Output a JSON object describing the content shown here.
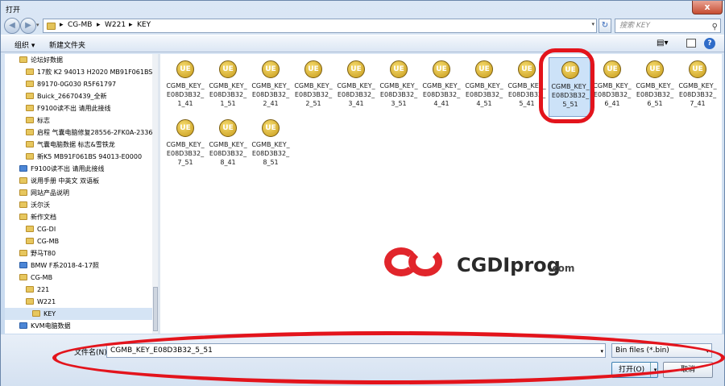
{
  "window": {
    "title": "打开",
    "close_label": "x"
  },
  "address": {
    "crumbs": [
      "▸",
      "CG-MB",
      "▸",
      "W221",
      "▸",
      "KEY"
    ],
    "search_placeholder": "搜索 KEY"
  },
  "toolbar": {
    "organize": "组织 ▾",
    "new_folder": "新建文件夹"
  },
  "nav_items": [
    {
      "label": "论坛好数据",
      "indent": 1,
      "icon": "folder"
    },
    {
      "label": "17款 K2  94013 H2020 MB91F061BS",
      "indent": 2,
      "icon": "folder"
    },
    {
      "label": "89170-0G030   R5F61797",
      "indent": 2,
      "icon": "folder"
    },
    {
      "label": "Buick_26670439_全新",
      "indent": 2,
      "icon": "folder"
    },
    {
      "label": "F9100读不出 请用此接线",
      "indent": 2,
      "icon": "folder"
    },
    {
      "label": "标志",
      "indent": 2,
      "icon": "folder"
    },
    {
      "label": "启程 气囊电脑修复28556-2FK0A-2336",
      "indent": 2,
      "icon": "folder"
    },
    {
      "label": "气囊电脑数据  标志&雪铁龙",
      "indent": 2,
      "icon": "folder"
    },
    {
      "label": "新K5   MB91F061BS   94013-E0000",
      "indent": 2,
      "icon": "folder"
    },
    {
      "label": "F9100读不出 请用此接线",
      "indent": 1,
      "icon": "doc"
    },
    {
      "label": "说用手册 中英文 双语板",
      "indent": 1,
      "icon": "folder"
    },
    {
      "label": "网站产品说明",
      "indent": 1,
      "icon": "folder"
    },
    {
      "label": "沃尔沃",
      "indent": 1,
      "icon": "folder"
    },
    {
      "label": "新作文档",
      "indent": 1,
      "icon": "folder"
    },
    {
      "label": "CG-DI",
      "indent": 2,
      "icon": "folder"
    },
    {
      "label": "CG-MB",
      "indent": 2,
      "icon": "folder"
    },
    {
      "label": "野马T80",
      "indent": 1,
      "icon": "folder"
    },
    {
      "label": "BMW F系2018-4-17照",
      "indent": 1,
      "icon": "doc"
    },
    {
      "label": "CG-MB",
      "indent": 1,
      "icon": "folder"
    },
    {
      "label": "221",
      "indent": 2,
      "icon": "folder"
    },
    {
      "label": "W221",
      "indent": 2,
      "icon": "folder"
    },
    {
      "label": "KEY",
      "indent": 3,
      "icon": "folder",
      "selected": true
    },
    {
      "label": "KVM电脑数据",
      "indent": 1,
      "icon": "doc"
    }
  ],
  "files": [
    {
      "name": "CGMB_KEY_E08D3B32_1_41"
    },
    {
      "name": "CGMB_KEY_E08D3B32_1_51"
    },
    {
      "name": "CGMB_KEY_E08D3B32_2_41"
    },
    {
      "name": "CGMB_KEY_E08D3B32_2_51"
    },
    {
      "name": "CGMB_KEY_E08D3B32_3_41"
    },
    {
      "name": "CGMB_KEY_E08D3B32_3_51"
    },
    {
      "name": "CGMB_KEY_E08D3B32_4_41"
    },
    {
      "name": "CGMB_KEY_E08D3B32_4_51"
    },
    {
      "name": "CGMB_KEY_E08D3B32_5_41"
    },
    {
      "name": "CGMB_KEY_E08D3B32_5_51",
      "selected": true
    },
    {
      "name": "CGMB_KEY_E08D3B32_6_41"
    },
    {
      "name": "CGMB_KEY_E08D3B32_6_51"
    },
    {
      "name": "CGMB_KEY_E08D3B32_7_41"
    },
    {
      "name": "CGMB_KEY_E08D3B32_7_51"
    },
    {
      "name": "CGMB_KEY_E08D3B32_8_41"
    },
    {
      "name": "CGMB_KEY_E08D3B32_8_51"
    }
  ],
  "file_icon_label": "UE",
  "watermark": {
    "text": "CGDIprog",
    "suffix": ".com"
  },
  "bottom": {
    "filename_label": "文件名(N):",
    "filename_value": "CGMB_KEY_E08D3B32_5_51",
    "filter_value": "Bin files (*.bin)",
    "open_label": "打开(O)",
    "cancel_label": "取消"
  },
  "colors": {
    "highlight_red": "#e3141c",
    "selection_blue": "#cce2f8"
  }
}
